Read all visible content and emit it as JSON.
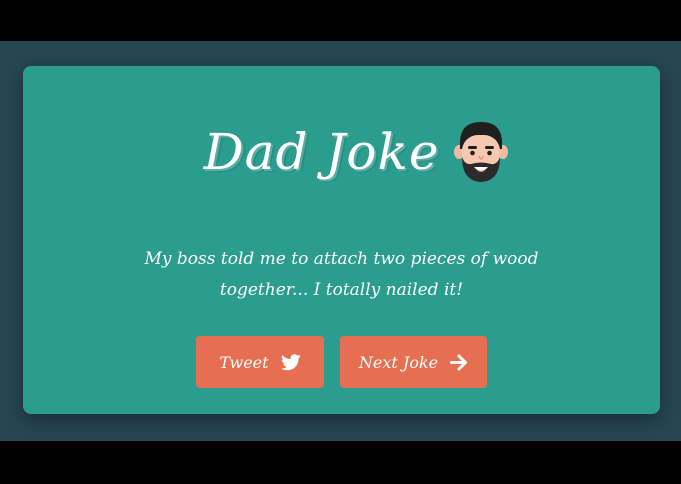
{
  "page": {
    "title": "Dad Joke",
    "joke_text": "My boss told me to attach two pieces of wood together... I totally nailed it!"
  },
  "buttons": {
    "tweet_label": "Tweet",
    "tweet_icon": "twitter-bird-icon",
    "next_label": "Next Joke",
    "next_icon": "arrow-right-icon"
  },
  "colors": {
    "outer_background": "#264653",
    "card_background": "#2a9d8f",
    "button_background": "#e76f51",
    "text": "#ffffff"
  },
  "icons": {
    "title_icon": "dad-face-emoji-icon"
  }
}
